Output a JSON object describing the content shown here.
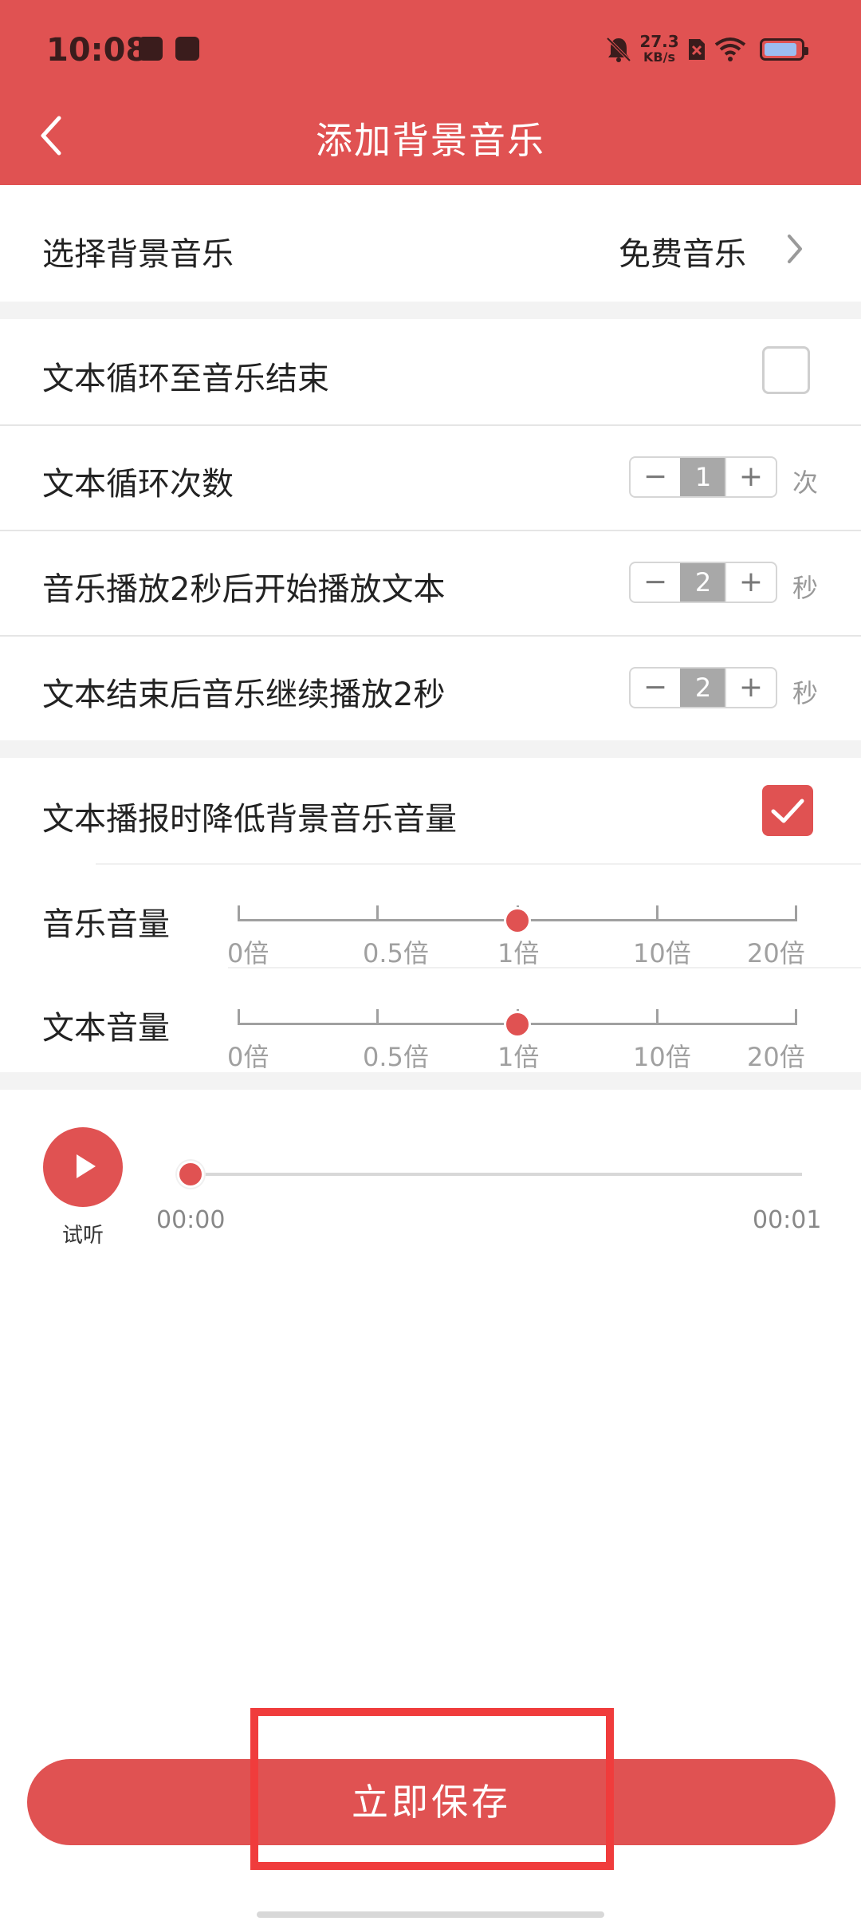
{
  "status_bar": {
    "time": "10:08",
    "network_speed_value": "27.3",
    "network_speed_unit": "KB/s",
    "battery_fill_fraction": 0.9
  },
  "header": {
    "title": "添加背景音乐"
  },
  "background_music": {
    "label": "选择背景音乐",
    "value": "免费音乐"
  },
  "loop_to_end": {
    "label": "文本循环至音乐结束",
    "checked": false
  },
  "loop_count": {
    "label": "文本循环次数",
    "minus": "−",
    "value": "1",
    "plus": "+",
    "unit": "次"
  },
  "delay_start": {
    "label": "音乐播放2秒后开始播放文本",
    "minus": "−",
    "value": "2",
    "plus": "+",
    "unit": "秒"
  },
  "continue_after": {
    "label": "文本结束后音乐继续播放2秒",
    "minus": "−",
    "value": "2",
    "plus": "+",
    "unit": "秒"
  },
  "duck_volume": {
    "label": "文本播报时降低背景音乐音量",
    "checked": true
  },
  "music_volume": {
    "label": "音乐音量",
    "ticks": [
      "0倍",
      "0.5倍",
      "1倍",
      "10倍",
      "20倍"
    ],
    "selected": "1倍"
  },
  "text_volume": {
    "label": "文本音量",
    "ticks": [
      "0倍",
      "0.5倍",
      "1倍",
      "10倍",
      "20倍"
    ],
    "selected": "1倍"
  },
  "preview": {
    "listen_label": "试听",
    "current_time": "00:00",
    "total_time": "00:01",
    "progress_fraction": 0
  },
  "save_button": {
    "label": "立即保存"
  },
  "colors": {
    "accent": "#e05252",
    "highlight": "#f03c3c"
  }
}
